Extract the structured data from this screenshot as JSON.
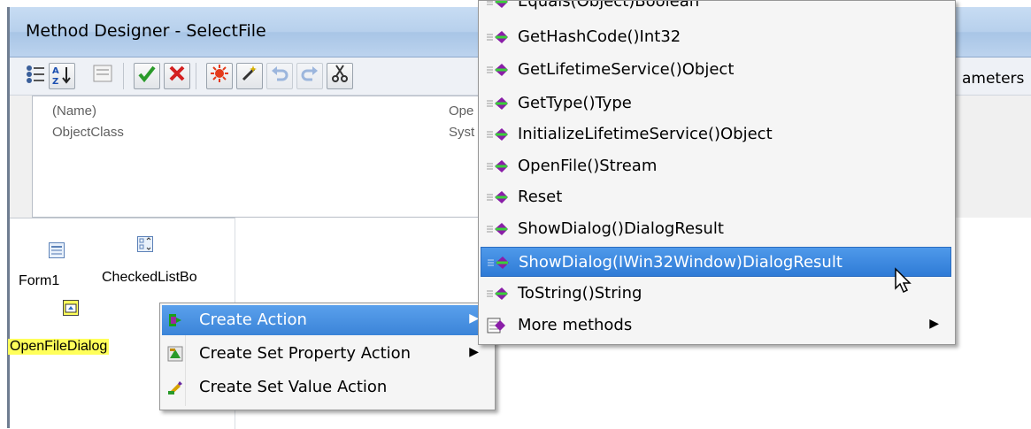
{
  "window": {
    "title": "Method Designer - SelectFile"
  },
  "toolbar": {
    "parameters_tab_label": "ameters"
  },
  "property_grid": {
    "rows": [
      {
        "name": "(Name)",
        "value": "Ope"
      },
      {
        "name": "ObjectClass",
        "value": "Syst"
      }
    ]
  },
  "component_tray": {
    "items": [
      {
        "label": "Form1"
      },
      {
        "label": "CheckedListBo"
      },
      {
        "label": "OpenFileDialog"
      }
    ]
  },
  "context_menu": {
    "items": [
      {
        "label": "Create Action",
        "highlighted": true,
        "has_submenu": true
      },
      {
        "label": "Create Set Property Action",
        "highlighted": false,
        "has_submenu": true
      },
      {
        "label": "Create Set Value Action",
        "highlighted": false,
        "has_submenu": false
      }
    ]
  },
  "submenu": {
    "items": [
      {
        "label": "Equals(Object)Boolean"
      },
      {
        "label": "GetHashCode()Int32"
      },
      {
        "label": "GetLifetimeService()Object"
      },
      {
        "label": "GetType()Type"
      },
      {
        "label": "InitializeLifetimeService()Object"
      },
      {
        "label": "OpenFile()Stream"
      },
      {
        "label": "Reset"
      },
      {
        "label": "ShowDialog()DialogResult"
      },
      {
        "label": "ShowDialog(IWin32Window)DialogResult"
      },
      {
        "label": "ToString()String"
      },
      {
        "label": "More methods"
      }
    ]
  },
  "colors": {
    "highlight": "#3b84d8",
    "selection_yellow": "#ffff5a",
    "menu_bg": "#f5f5f5",
    "title_bar": "#b7d0ec"
  }
}
